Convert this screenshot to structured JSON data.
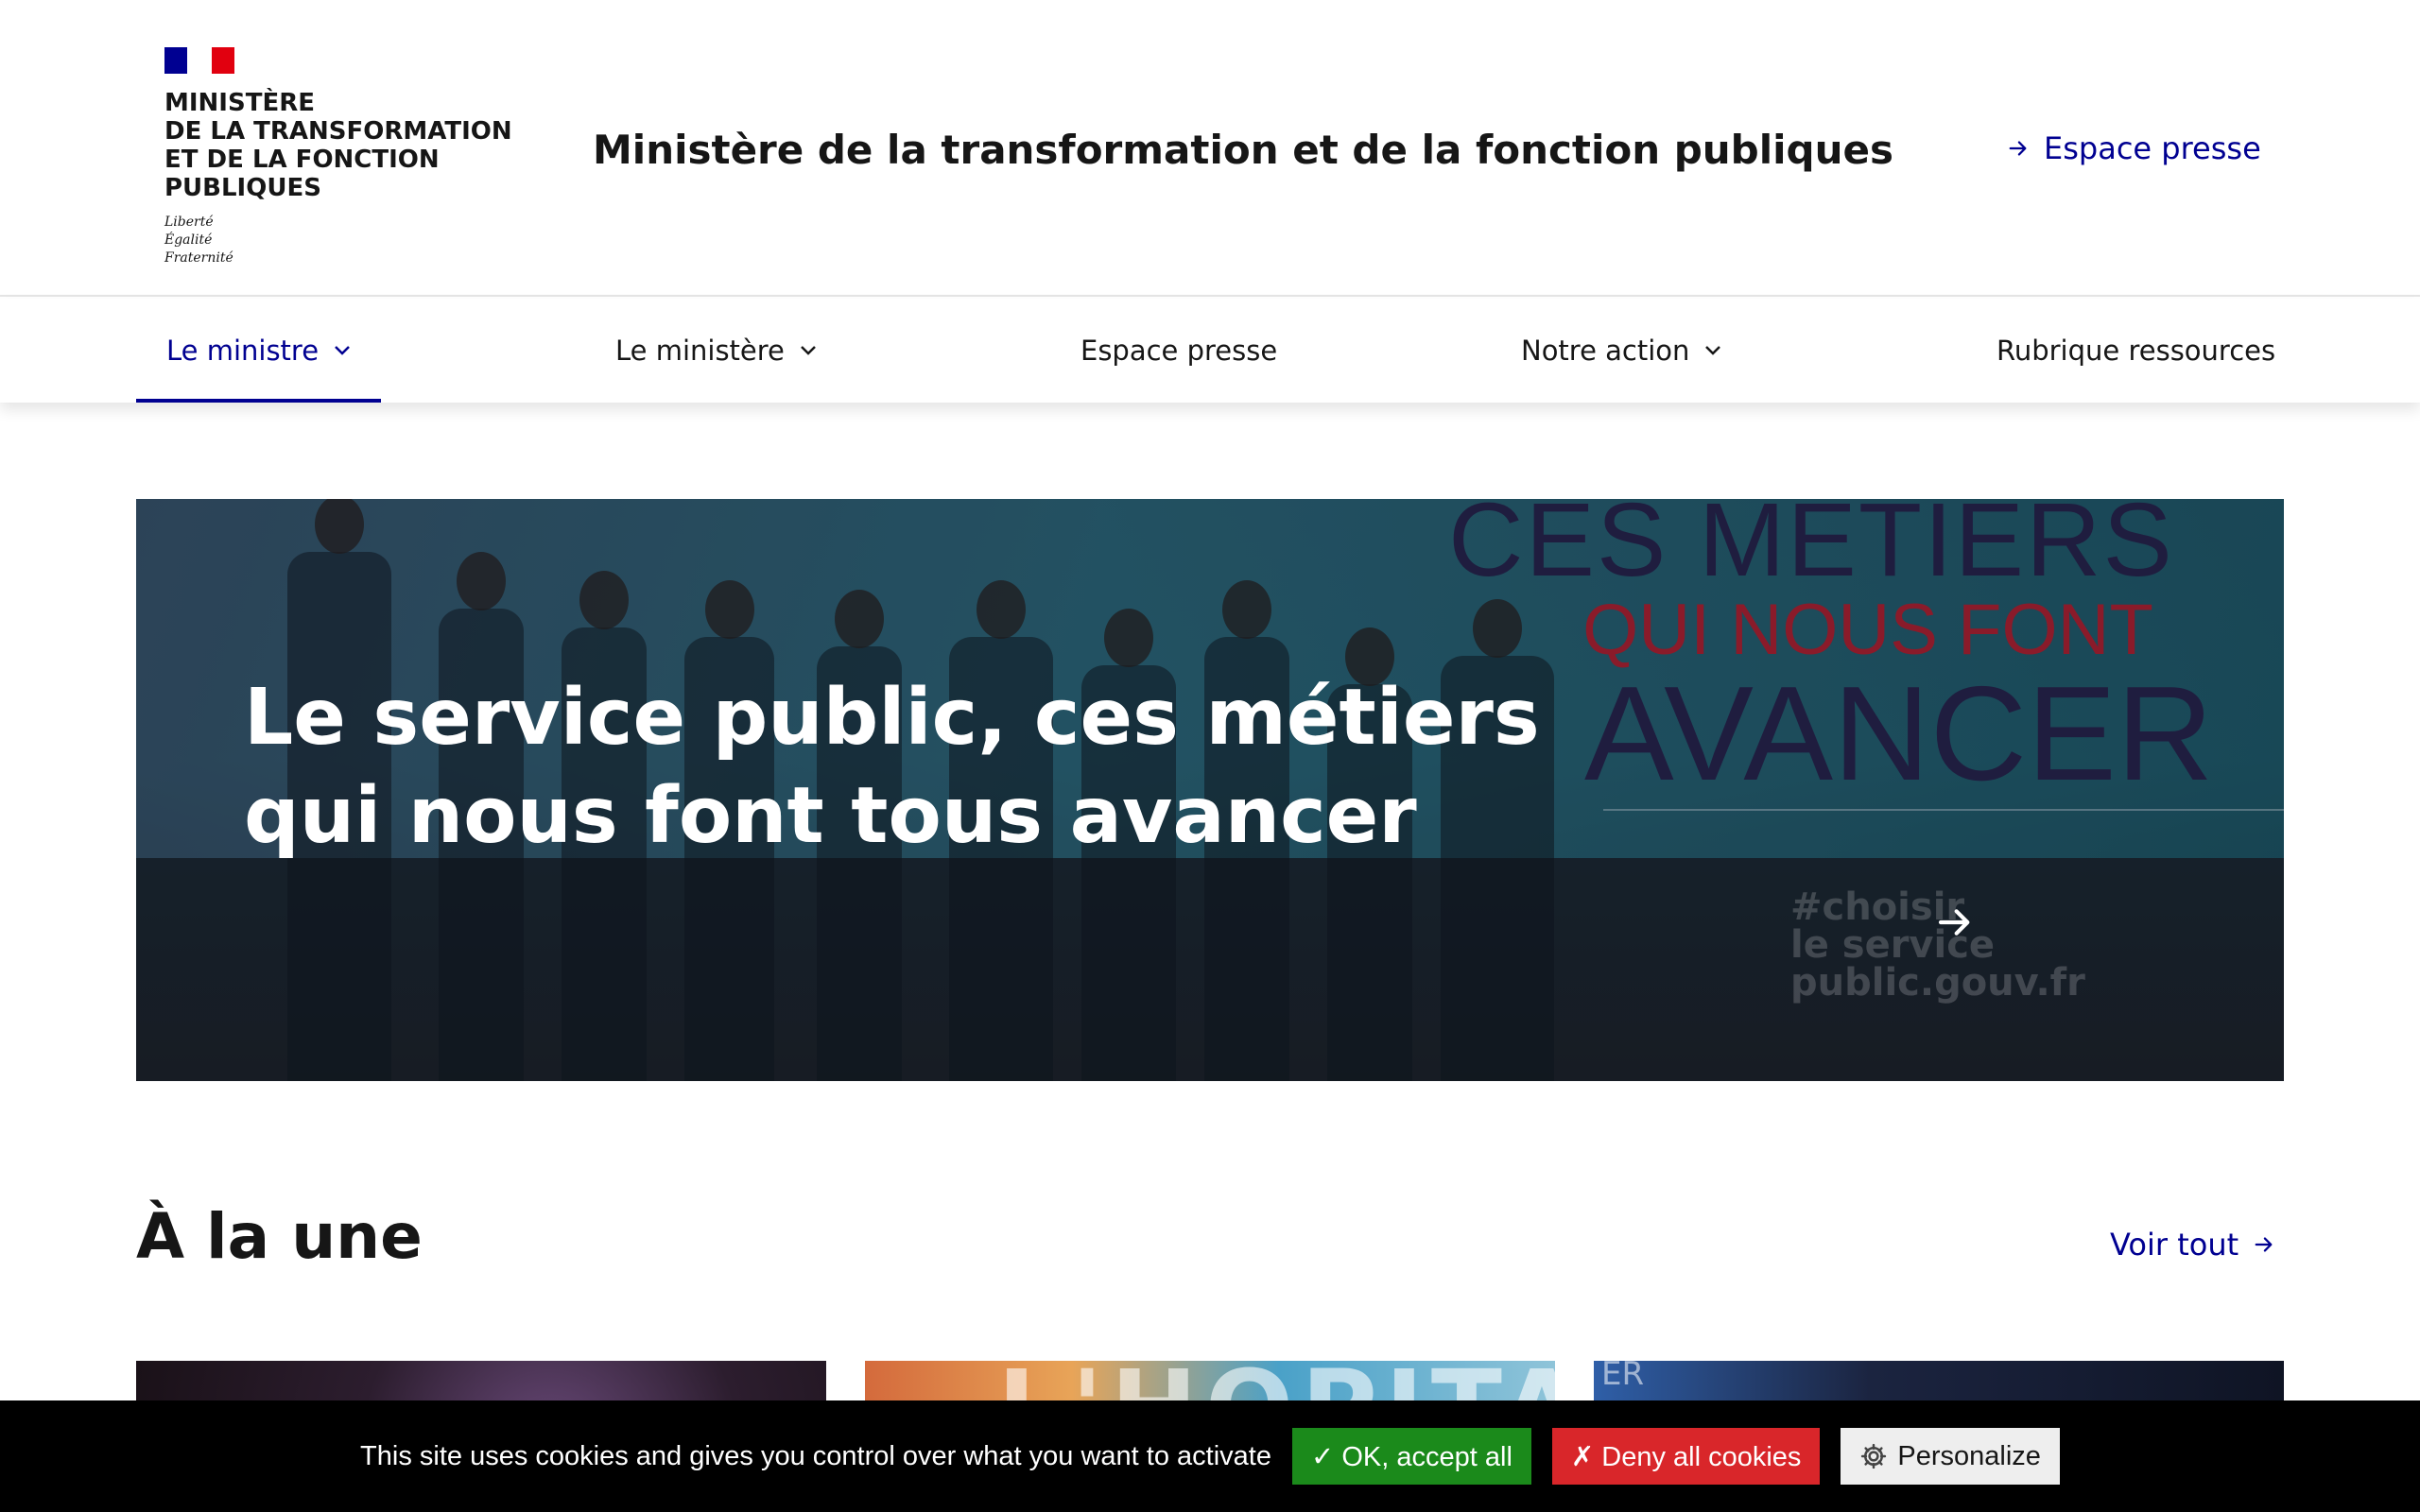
{
  "header": {
    "logo_text": "MINISTÈRE\nDE LA TRANSFORMATION\nET DE LA FONCTION\nPUBLIQUES",
    "motto": "Liberté\nÉgalité\nFraternité",
    "site_title": "Ministère de la transformation et de la fonction publiques",
    "quick_link": "Espace presse",
    "colors": {
      "blue": "#000091",
      "red": "#e1000f"
    }
  },
  "nav": {
    "items": [
      {
        "label": "Le ministre",
        "has_dropdown": true,
        "active": true
      },
      {
        "label": "Le ministère",
        "has_dropdown": true,
        "active": false
      },
      {
        "label": "Espace presse",
        "has_dropdown": false,
        "active": false
      },
      {
        "label": "Notre action",
        "has_dropdown": true,
        "active": false
      },
      {
        "label": "Rubrique ressources",
        "has_dropdown": false,
        "active": false
      }
    ]
  },
  "hero": {
    "title": "Le service public, ces métiers qui nous font tous avancer",
    "campaign_line1": "CES METIERS",
    "campaign_line2": "QUI NOUS FONT",
    "campaign_line3": "AVANCER",
    "hashtag": "#choisir\nle service\npublic.gouv.fr",
    "arrow_icon": "arrow-right-icon"
  },
  "section": {
    "title": "À la une",
    "see_all": "Voir tout",
    "card2_text": "L'HOPITAL",
    "card3_text": "ER"
  },
  "cookie_bar": {
    "message": "This site uses cookies and gives you control over what you want to activate",
    "accept": "✓ OK, accept all",
    "deny": "✗ Deny all cookies",
    "personalize": "Personalize",
    "colors": {
      "accept": "#1b8a1b",
      "deny": "#d9262a"
    }
  }
}
